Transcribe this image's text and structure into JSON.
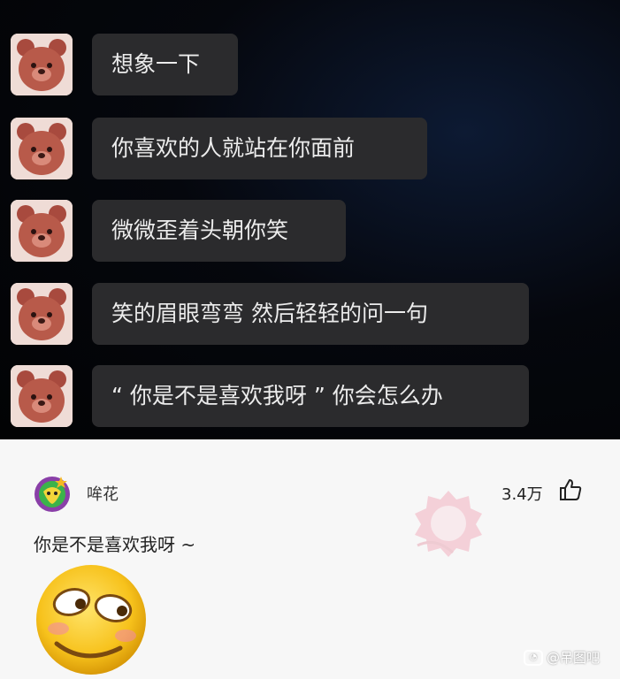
{
  "chat": {
    "messages": [
      {
        "text": "想象一下"
      },
      {
        "text": "你喜欢的人就站在你面前"
      },
      {
        "text": "微微歪着头朝你笑"
      },
      {
        "text": "笑的眉眼弯弯 然后轻轻的问一句"
      },
      {
        "text": "“ 你是不是喜欢我呀 ” 你会怎么办"
      }
    ]
  },
  "comment": {
    "username": "哞花",
    "likes": "3.4万",
    "text": "你是不是喜欢我呀 ~"
  },
  "watermark": {
    "text": "@吊图吧"
  },
  "colors": {
    "chat_bg": "#05070d",
    "bubble_bg": "#2b2b2d",
    "bubble_text": "#ececec",
    "comment_bg": "#f7f7f7"
  },
  "icons": [
    "bear-avatar-icon",
    "like-thumb-icon",
    "user-avatar-icon",
    "smirk-emoji-icon",
    "stamp-icon"
  ]
}
